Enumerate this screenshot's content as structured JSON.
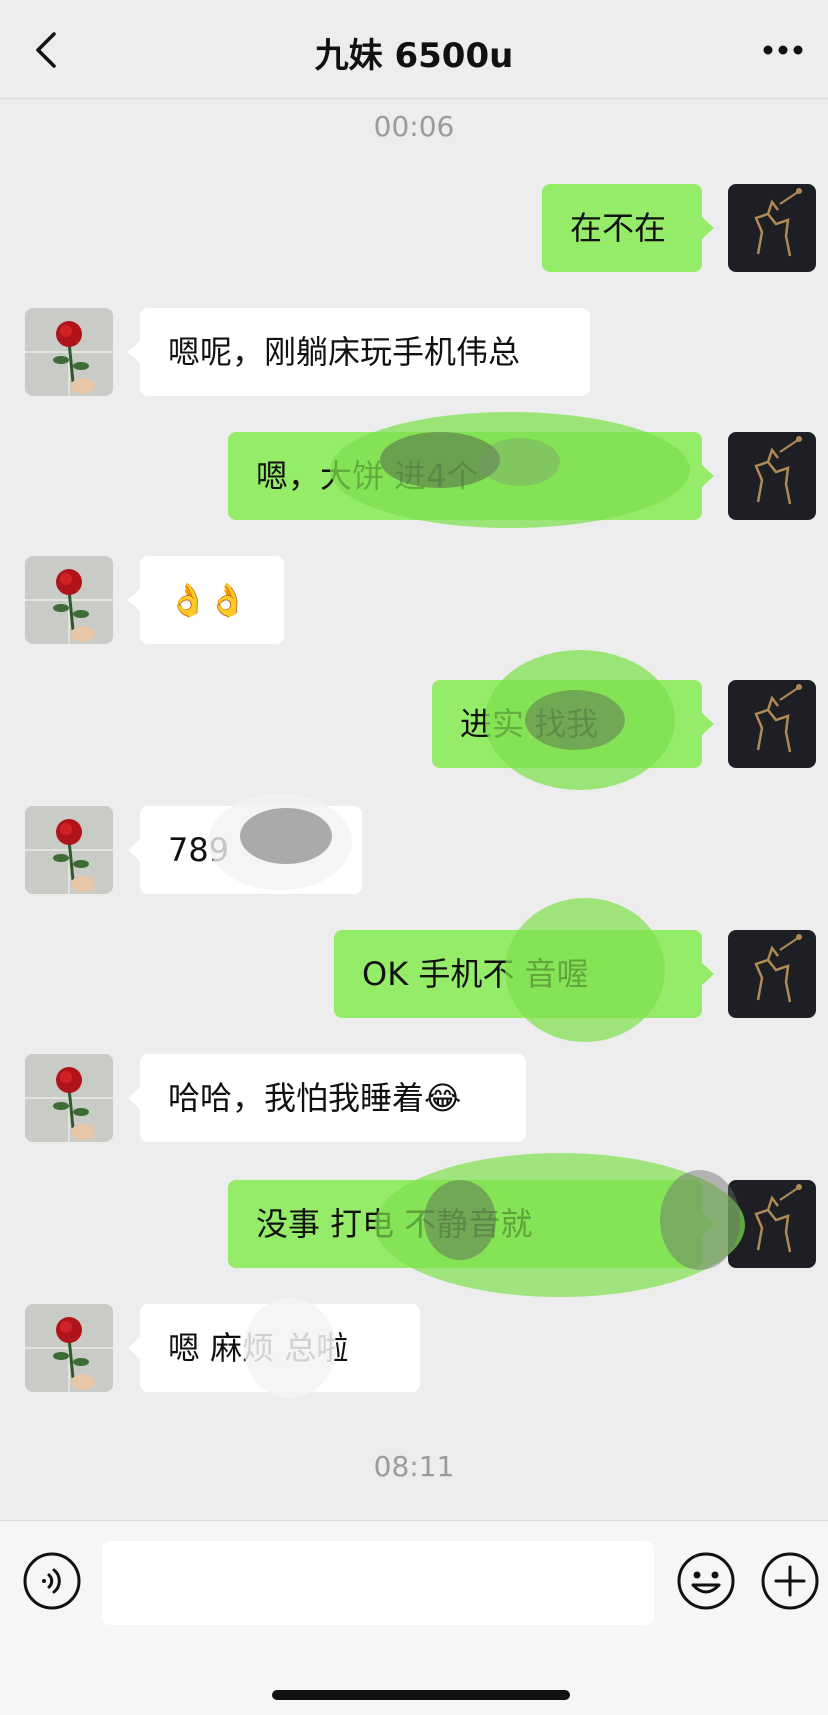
{
  "header": {
    "title": "九妹 6500u",
    "back_icon": "chevron-left-icon",
    "more_icon": "more-dots-icon"
  },
  "timestamps": [
    "00:06",
    "08:11"
  ],
  "messages": [
    {
      "from": "me",
      "text": "在不在"
    },
    {
      "from": "other",
      "text": "嗯呢，刚躺床玩手机伟总"
    },
    {
      "from": "me",
      "text": "嗯，大饼          进4个"
    },
    {
      "from": "other",
      "text": "👌👌"
    },
    {
      "from": "me",
      "text": "进实        找我"
    },
    {
      "from": "other",
      "text": "789"
    },
    {
      "from": "me",
      "text": "OK 手机不      音喔"
    },
    {
      "from": "other",
      "text": "哈哈，我怕我睡着😂"
    },
    {
      "from": "me",
      "text": "没事 打电        不静音就"
    },
    {
      "from": "other",
      "text": "嗯 麻烦  总啦"
    }
  ],
  "avatars": {
    "me": "horse-polo-avatar",
    "other": "rose-avatar"
  },
  "input_bar": {
    "voice_icon": "voice-icon",
    "text_value": "",
    "emoji_icon": "emoji-icon",
    "plus_icon": "plus-icon"
  },
  "colors": {
    "background": "#ededed",
    "bubble_mine": "#95ec69",
    "bubble_other": "#ffffff"
  }
}
